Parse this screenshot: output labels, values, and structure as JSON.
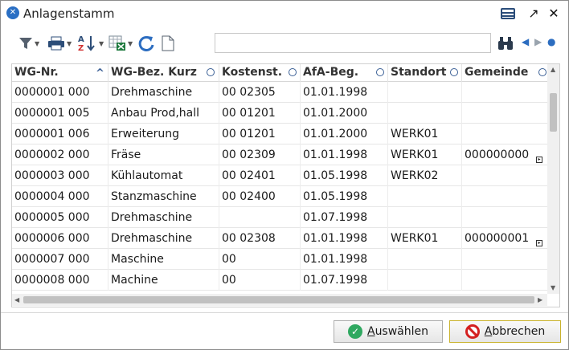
{
  "window": {
    "title": "Anlagenstamm",
    "app_icon": "x-logo-icon"
  },
  "toolbar": {
    "search_value": "",
    "icons": [
      "filter-icon",
      "print-icon",
      "sort-az-icon",
      "excel-export-icon",
      "refresh-icon",
      "new-document-icon",
      "binoculars-icon",
      "prev-arrow-icon",
      "next-arrow-icon",
      "record-dot-icon"
    ]
  },
  "grid": {
    "columns": [
      {
        "label": "WG-Nr."
      },
      {
        "label": "WG-Bez. Kurz"
      },
      {
        "label": "Kostenst."
      },
      {
        "label": "AfA-Beg."
      },
      {
        "label": "Standort"
      },
      {
        "label": "Gemeinde"
      }
    ],
    "rows": [
      {
        "wg_nr": "0000001 000",
        "bez": "Drehmaschine",
        "kst": "00 02305",
        "afa": "01.01.1998",
        "standort": "",
        "gemeinde": ""
      },
      {
        "wg_nr": "0000001 005",
        "bez": "Anbau Prod,hall",
        "kst": "00 01201",
        "afa": "01.01.2000",
        "standort": "",
        "gemeinde": ""
      },
      {
        "wg_nr": "0000001 006",
        "bez": "Erweiterung",
        "kst": "00 01201",
        "afa": "01.01.2000",
        "standort": "WERK01",
        "gemeinde": ""
      },
      {
        "wg_nr": "0000002 000",
        "bez": "Fräse",
        "kst": "00 02309",
        "afa": "01.01.1998",
        "standort": "WERK01",
        "gemeinde": "000000000"
      },
      {
        "wg_nr": "0000003 000",
        "bez": "Kühlautomat",
        "kst": "00 02401",
        "afa": "01.05.1998",
        "standort": "WERK02",
        "gemeinde": ""
      },
      {
        "wg_nr": "0000004 000",
        "bez": "Stanzmaschine",
        "kst": "00 02400",
        "afa": "01.05.1998",
        "standort": "",
        "gemeinde": ""
      },
      {
        "wg_nr": "0000005 000",
        "bez": "Drehmaschine",
        "kst": "",
        "afa": "01.07.1998",
        "standort": "",
        "gemeinde": ""
      },
      {
        "wg_nr": "0000006 000",
        "bez": "Drehmaschine",
        "kst": "00 02308",
        "afa": "01.01.1998",
        "standort": "WERK01",
        "gemeinde": "000000001"
      },
      {
        "wg_nr": "0000007 000",
        "bez": "Maschine",
        "kst": "00",
        "afa": "01.01.1998",
        "standort": "",
        "gemeinde": ""
      },
      {
        "wg_nr": "0000008 000",
        "bez": "Machine",
        "kst": "00",
        "afa": "01.07.1998",
        "standort": "",
        "gemeinde": ""
      }
    ]
  },
  "footer": {
    "ok_prefix": "A",
    "ok_rest": "uswählen",
    "cancel_prefix": "A",
    "cancel_rest": "bbrechen"
  }
}
